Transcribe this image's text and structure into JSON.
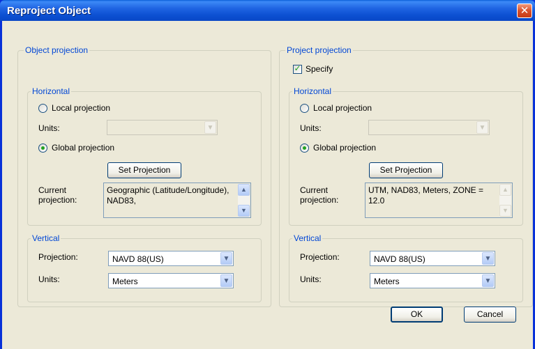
{
  "window": {
    "title": "Reproject Object",
    "close_glyph": "✕"
  },
  "object_projection": {
    "legend": "Object projection",
    "horizontal": {
      "legend": "Horizontal",
      "local_projection_label": "Local projection",
      "units_label": "Units:",
      "units_value": "",
      "global_projection_label": "Global projection",
      "selected": "global",
      "set_projection_label": "Set Projection",
      "current_projection_label_line1": "Current",
      "current_projection_label_line2": "projection:",
      "current_projection_value": "Geographic (Latitude/Longitude), NAD83,"
    },
    "vertical": {
      "legend": "Vertical",
      "projection_label": "Projection:",
      "projection_value": "NAVD 88(US)",
      "units_label": "Units:",
      "units_value": "Meters"
    }
  },
  "project_projection": {
    "legend": "Project projection",
    "specify_label": "Specify",
    "specify_checked": true,
    "horizontal": {
      "legend": "Horizontal",
      "local_projection_label": "Local projection",
      "units_label": "Units:",
      "units_value": "",
      "global_projection_label": "Global projection",
      "selected": "global",
      "set_projection_label": "Set Projection",
      "current_projection_label_line1": "Current",
      "current_projection_label_line2": "projection:",
      "current_projection_value": "UTM, NAD83, Meters, ZONE = 12.0"
    },
    "vertical": {
      "legend": "Vertical",
      "projection_label": "Projection:",
      "projection_value": "NAVD 88(US)",
      "units_label": "Units:",
      "units_value": "Meters"
    }
  },
  "buttons": {
    "ok": "OK",
    "cancel": "Cancel"
  },
  "icons": {
    "close": "close-icon",
    "dropdown": "chevron-down-icon",
    "scroll_up": "scroll-up-icon",
    "scroll_down": "scroll-down-icon",
    "check": "checkmark-icon"
  },
  "colors": {
    "titlebar": "#0a48c6",
    "group_legend": "#0046d5",
    "dialog_bg": "#ece9d8"
  }
}
